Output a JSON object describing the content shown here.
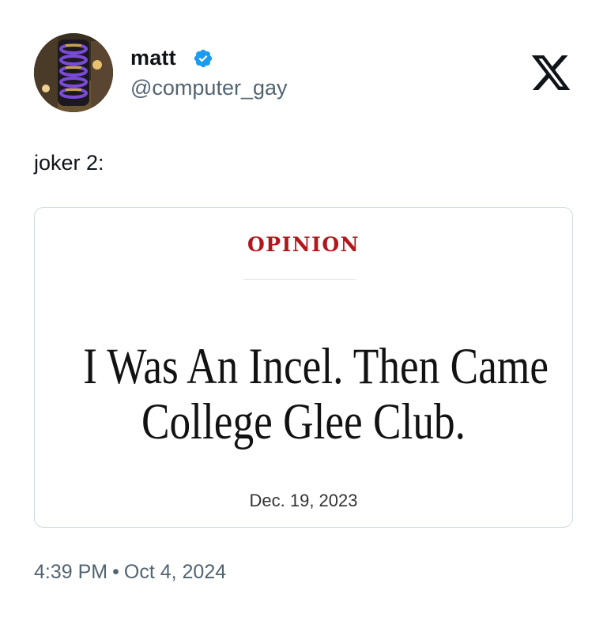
{
  "author": {
    "display_name": "matt",
    "handle": "@computer_gay",
    "avatar_icon": "avatar-photo",
    "verified_icon": "verified-badge-icon",
    "verified_color": "#1d9bf0"
  },
  "platform_icon": "x-logo-icon",
  "tweet": {
    "text": "joker 2:"
  },
  "card": {
    "section": "OPINION",
    "section_color": "#b3161b",
    "headline_line1": "I Was An Incel. Then Came",
    "headline_line2": "College Glee Club.",
    "date": "Dec. 19, 2023"
  },
  "footer": {
    "time": "4:39 PM",
    "separator": "•",
    "date": "Oct 4, 2024"
  }
}
